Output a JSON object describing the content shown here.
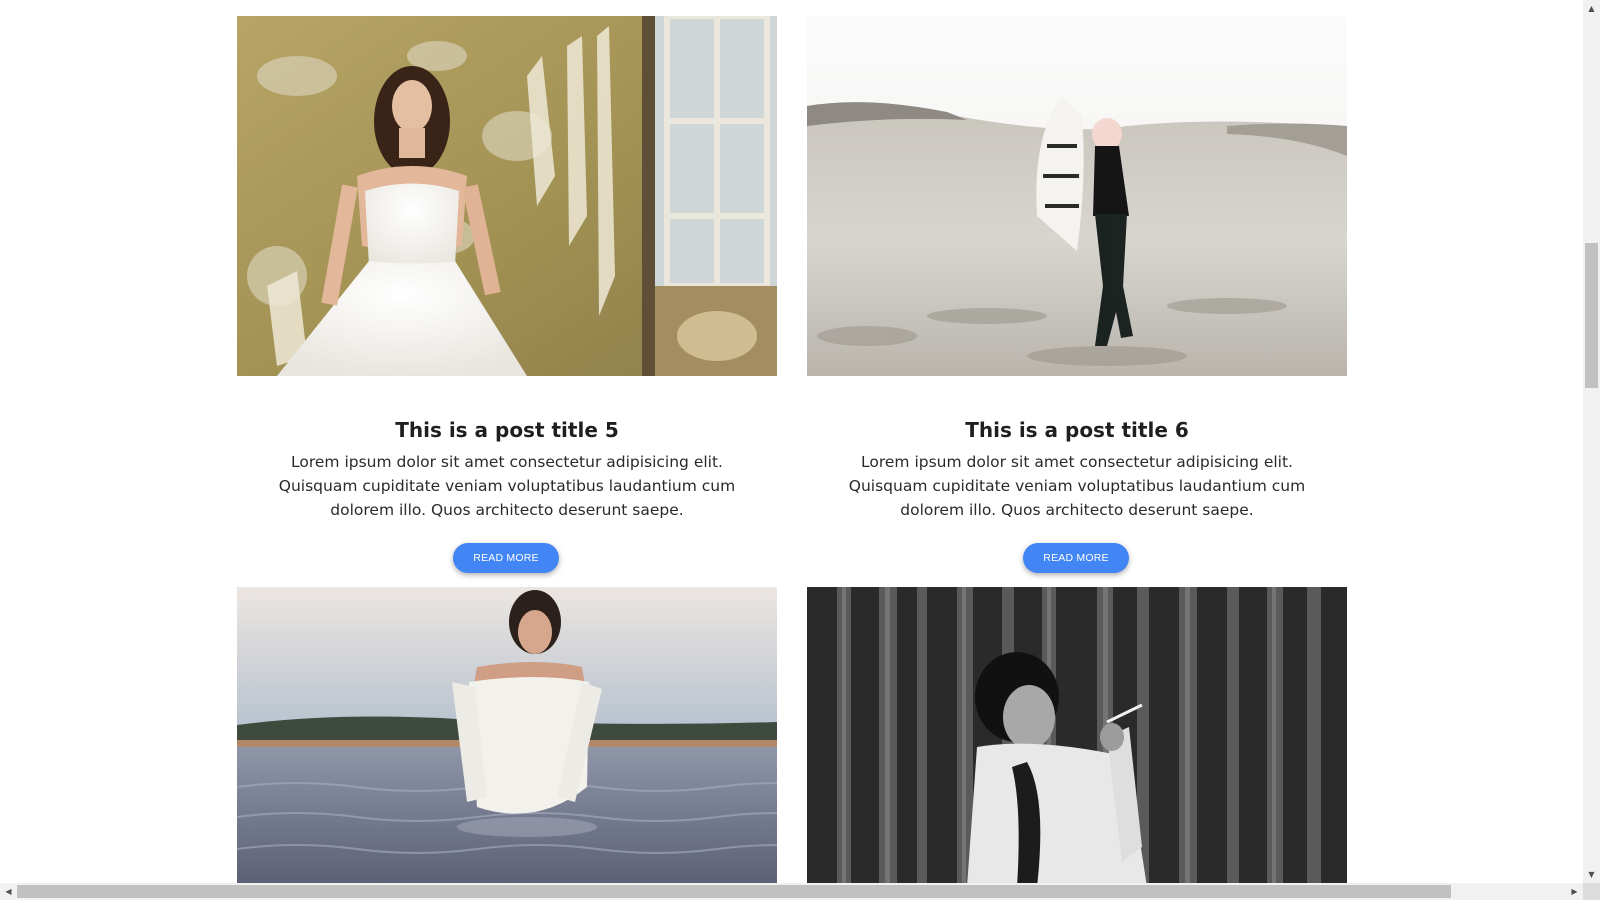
{
  "posts": [
    {
      "title": "This is a post title 5",
      "text": "Lorem ipsum dolor sit amet consectetur adipisicing elit. Quisquam cupiditate veniam voluptatibus laudantium cum dolorem illo. Quos architecto deserunt saepe.",
      "button": "READ MORE",
      "image": "bride-in-white-dress-by-window-photo"
    },
    {
      "title": "This is a post title 6",
      "text": "Lorem ipsum dolor sit amet consectetur adipisicing elit. Quisquam cupiditate veniam voluptatibus laudantium cum dolorem illo. Quos architecto deserunt saepe.",
      "button": "READ MORE",
      "image": "woman-walking-on-sand-dunes-photo"
    },
    {
      "image": "woman-in-white-dress-in-water-photo"
    },
    {
      "image": "black-and-white-woman-smoking-photo"
    }
  ],
  "colors": {
    "button": "#4285f4",
    "title": "#1f1f1f",
    "text": "#2a2a2a"
  }
}
